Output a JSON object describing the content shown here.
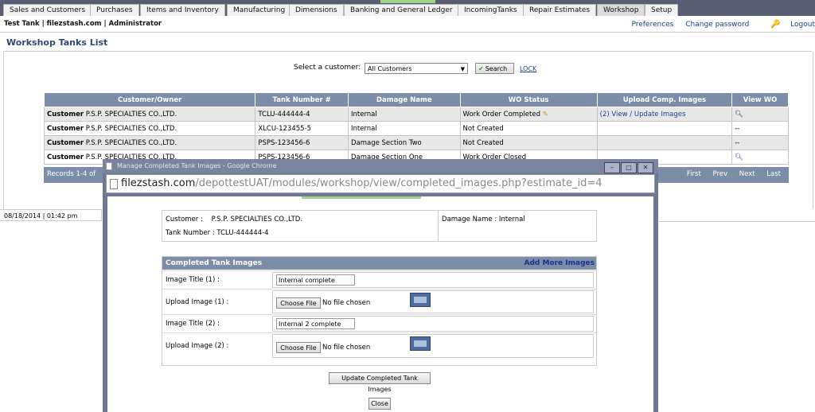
{
  "nav_tabs": [
    {
      "label": "Sales and Customers",
      "active": false
    },
    {
      "label": "Purchases",
      "active": false
    },
    {
      "label": "Items and Inventory",
      "active": false
    },
    {
      "label": "Manufacturing",
      "active": false
    },
    {
      "label": "Dimensions",
      "active": false
    },
    {
      "label": "Banking and General Ledger",
      "active": false
    },
    {
      "label": "IncomingTanks",
      "active": false
    },
    {
      "label": "Repair Estimates",
      "active": false
    },
    {
      "label": "Workshop",
      "active": true
    },
    {
      "label": "Setup",
      "active": false
    }
  ],
  "userbar": {
    "who": "Test Tank | filezstash.com | Administrator",
    "preferences": "Preferences",
    "change_password": "Change password",
    "logout": "Logout"
  },
  "page": {
    "title": "Workshop Tanks List",
    "customer_label": "Select a customer:",
    "customer_value": "All Customers",
    "search_label": "Search",
    "lock_label": "LOCK"
  },
  "grid": {
    "headers": [
      "Customer/Owner",
      "Tank Number #",
      "Damage Name",
      "WO Status",
      "Upload Comp. Images",
      "View WO"
    ],
    "rows": [
      {
        "customer_prefix": "Customer",
        "customer": "P.S.P. SPECIALTIES CO.,LTD.",
        "tank": "TCLU-444444-4",
        "damage": "Internal",
        "status": "Work Order Completed",
        "upload": "(2) View / Update Images",
        "view": ""
      },
      {
        "customer_prefix": "Customer",
        "customer": "P.S.P. SPECIALTIES CO.,LTD.",
        "tank": "XLCU-123455-5",
        "damage": "Internal",
        "status": "Not Created",
        "upload": "",
        "view": "--"
      },
      {
        "customer_prefix": "Customer",
        "customer": "P.S.P. SPECIALTIES CO.,LTD.",
        "tank": "PSPS-123456-6",
        "damage": "Damage Section Two",
        "status": "Not Created",
        "upload": "",
        "view": "--"
      },
      {
        "customer_prefix": "Customer",
        "customer": "P.S.P. SPECIALTIES CO.,LTD.",
        "tank": "PSPS-123456-6",
        "damage": "Damage Section One",
        "status": "Work Order Closed",
        "upload": "",
        "view": ""
      }
    ],
    "records": "Records 1-4 of",
    "pager": [
      "First",
      "Prev",
      "Next",
      "Last"
    ]
  },
  "footer": {
    "datetime": "08/18/2014 | 01:42 pm"
  },
  "popup": {
    "window_title": "Manage Completed Tank Images - Google Chrome",
    "url_host": "filezstash.com",
    "url_path": "/depottestUAT/modules/workshop/view/completed_images.php?estimate_id=4",
    "customer_label": "Customer :",
    "customer_value": "P.S.P. SPECIALTIES CO.,LTD.",
    "tank_label": "Tank Number :",
    "tank_value": "TCLU-444444-4",
    "damage_label": "Damage Name :",
    "damage_value": "Internal",
    "images_header": "Completed Tank Images",
    "add_more": "Add More Images",
    "title1_label": "Image Title (1) :",
    "title1_value": "Internal complete",
    "upload1_label": "Upload Image (1) :",
    "title2_label": "Image Title (2) :",
    "title2_value": "Internal 2 complete",
    "upload2_label": "Upload Image (2) :",
    "choose_file": "Choose File",
    "no_file": "No file chosen",
    "update_btn": "Update Completed Tank Images",
    "close_btn": "Close"
  }
}
